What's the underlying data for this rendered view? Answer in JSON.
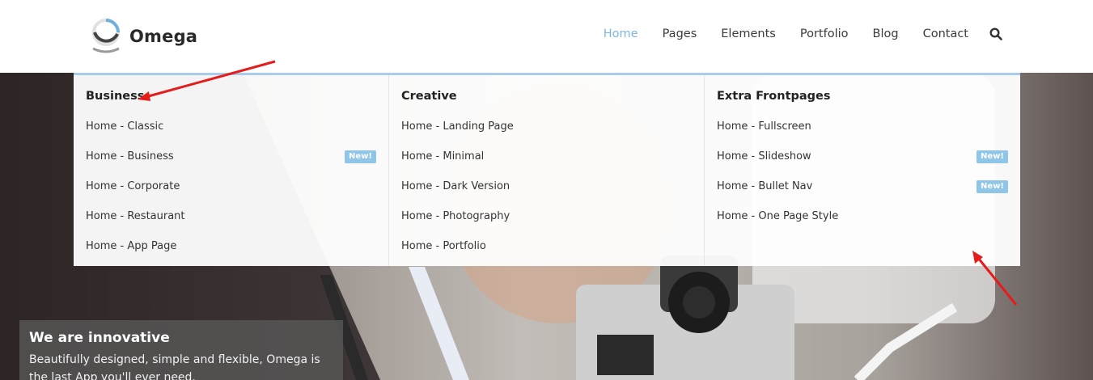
{
  "brand": {
    "name": "Omega"
  },
  "nav": {
    "items": [
      {
        "label": "Home",
        "active": true
      },
      {
        "label": "Pages",
        "active": false
      },
      {
        "label": "Elements",
        "active": false
      },
      {
        "label": "Portfolio",
        "active": false
      },
      {
        "label": "Blog",
        "active": false
      },
      {
        "label": "Contact",
        "active": false
      }
    ],
    "search_icon": "search-icon"
  },
  "mega_menu": {
    "columns": [
      {
        "title": "Business",
        "links": [
          {
            "label": "Home - Classic",
            "badge": ""
          },
          {
            "label": "Home - Business",
            "badge": "New!"
          },
          {
            "label": "Home - Corporate",
            "badge": ""
          },
          {
            "label": "Home - Restaurant",
            "badge": ""
          },
          {
            "label": "Home - App Page",
            "badge": ""
          }
        ]
      },
      {
        "title": "Creative",
        "links": [
          {
            "label": "Home - Landing Page",
            "badge": ""
          },
          {
            "label": "Home - Minimal",
            "badge": ""
          },
          {
            "label": "Home - Dark Version",
            "badge": ""
          },
          {
            "label": "Home - Photography",
            "badge": ""
          },
          {
            "label": "Home - Portfolio",
            "badge": ""
          }
        ]
      },
      {
        "title": "Extra Frontpages",
        "links": [
          {
            "label": "Home - Fullscreen",
            "badge": ""
          },
          {
            "label": "Home - Slideshow",
            "badge": "New!"
          },
          {
            "label": "Home - Bullet Nav",
            "badge": "New!"
          },
          {
            "label": "Home - One Page Style",
            "badge": ""
          }
        ]
      }
    ]
  },
  "hero": {
    "heading": "We are innovative",
    "text": "Beautifully designed, simple and flexible, Omega is the last App you'll ever need."
  },
  "colors": {
    "accent": "#7fb6dd",
    "badge": "#8fc6e8",
    "annotation_arrow": "#e51c1c"
  }
}
